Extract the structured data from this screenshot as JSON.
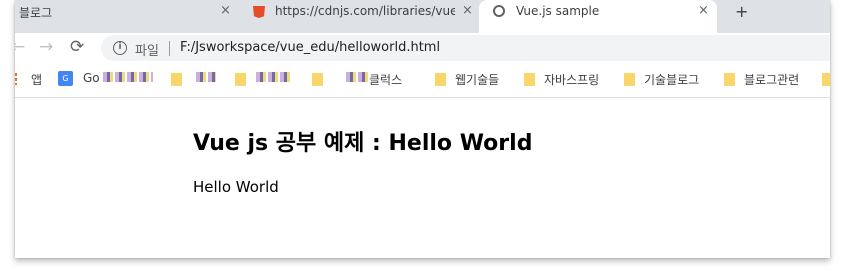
{
  "browser": {
    "tabs": [
      {
        "title": "블로그",
        "state": "inactive"
      },
      {
        "title": "https://cdnjs.com/libraries/vue",
        "state": "inactive",
        "icon": "shield-icon"
      },
      {
        "title": "Vue.js sample",
        "state": "active",
        "icon": "globe-icon"
      }
    ],
    "new_tab_label": "+",
    "close_glyph": "×",
    "nav": {
      "back": "←",
      "forward": "→",
      "reload": "⟳"
    },
    "address_bar": {
      "scheme_label": "파일",
      "url": "F:/Jsworkspace/vue_edu/helloworld.html",
      "info_glyph": "i"
    },
    "bookmarks": [
      {
        "label": "앱",
        "icon": "apps-icon"
      },
      {
        "label": "Go",
        "icon": "google-icon",
        "note": "remaining text obscured"
      },
      {
        "label": "클럭스",
        "icon": "folder-icon"
      },
      {
        "label": "웹기술들",
        "icon": "folder-icon"
      },
      {
        "label": "자바스프링",
        "icon": "folder-icon"
      },
      {
        "label": "기술블로그",
        "icon": "folder-icon"
      },
      {
        "label": "블로그관련",
        "icon": "folder-icon"
      }
    ]
  },
  "page": {
    "heading": "Vue js 공부 예제 : Hello World",
    "message": "Hello World"
  }
}
